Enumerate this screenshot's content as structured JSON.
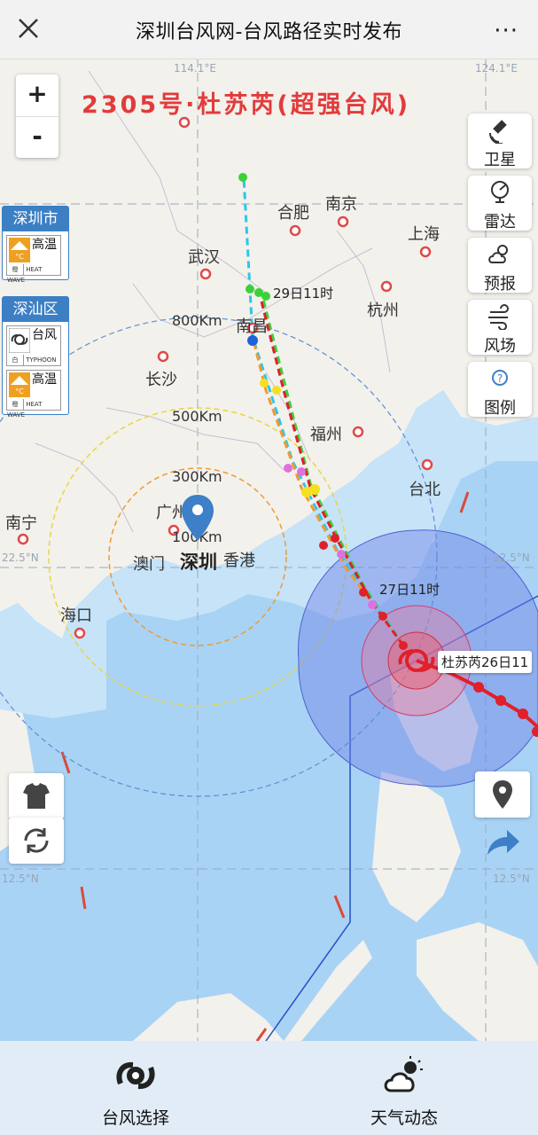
{
  "topbar": {
    "title": "深圳台风网-台风路径实时发布",
    "more": "···"
  },
  "storm": {
    "title": "2305号·杜苏芮(超强台风)",
    "current_label": "杜苏芮26日11",
    "forecast_label_1": "27日11时",
    "forecast_label_2": "29日11时"
  },
  "zoom": {
    "in": "+",
    "out": "-"
  },
  "alerts": {
    "shenzhen": {
      "header": "深圳市",
      "items": [
        {
          "text": "高温",
          "level": "橙",
          "en": "HEAT WAVE"
        }
      ]
    },
    "shenshan": {
      "header": "深汕区",
      "items": [
        {
          "text": "台风",
          "level": "白",
          "en": "TYPHOON"
        },
        {
          "text": "高温",
          "level": "橙",
          "en": "HEAT WAVE"
        }
      ]
    }
  },
  "right_buttons": [
    {
      "label": "卫星",
      "icon": "satellite-icon"
    },
    {
      "label": "雷达",
      "icon": "radar-icon"
    },
    {
      "label": "预报",
      "icon": "forecast-icon"
    },
    {
      "label": "风场",
      "icon": "wind-icon"
    },
    {
      "label": "图例",
      "icon": "legend-icon"
    }
  ],
  "cities": {
    "hefei": "合肥",
    "nanjing": "南京",
    "shanghai": "上海",
    "wuhan": "武汉",
    "hangzhou": "杭州",
    "nanchang": "南昌",
    "changsha": "长沙",
    "fuzhou": "福州",
    "taibei": "台北",
    "nanning": "南宁",
    "guangzhou": "广州",
    "macau": "澳门",
    "hongkong": "香港",
    "haikou": "海口",
    "shenzhen": "深圳"
  },
  "grid_labels": {
    "lon_114": "114.1°E",
    "lon_124": "124.1°E",
    "lat_22_left": "22.5°N",
    "lat_22_right": "22.5°N",
    "lat_12_left": "12.5°N",
    "lat_12_right": "12.5°N"
  },
  "rings": {
    "r100": "100Km",
    "r300": "300Km",
    "r500": "500Km",
    "r800": "800Km"
  },
  "bottom": {
    "typhoon_select": "台风选择",
    "weather": "天气动态"
  },
  "colors": {
    "track_red": "#e0202a",
    "forecast_green": "#3ad23a",
    "forecast_cyan": "#2cc6e8",
    "forecast_orange": "#f09a30",
    "pin_blue": "#3d7fc8",
    "title_red": "#e23b3b"
  }
}
